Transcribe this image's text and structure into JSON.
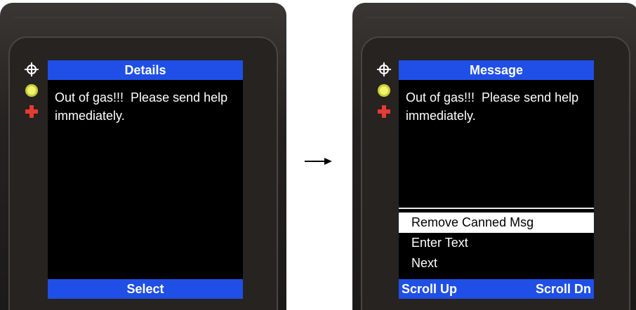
{
  "left_device": {
    "header": "Details",
    "message": "Out of gas!!!  Please send help immediately.",
    "softkey": "Select"
  },
  "right_device": {
    "header": "Message",
    "message": "Out of gas!!!  Please send help immediately.",
    "menu": [
      {
        "label": "Remove Canned Msg",
        "selected": true
      },
      {
        "label": "Enter Text",
        "selected": false
      },
      {
        "label": "Next",
        "selected": false
      }
    ],
    "softkey_left": "Scroll Up",
    "softkey_right": "Scroll Dn"
  },
  "indicators": [
    "crosshair-icon",
    "status-led-icon",
    "plus-icon"
  ],
  "colors": {
    "accent_blue": "#1f4fe6",
    "led_yellow": "#f2f56b",
    "plus_red": "#e53b31"
  }
}
